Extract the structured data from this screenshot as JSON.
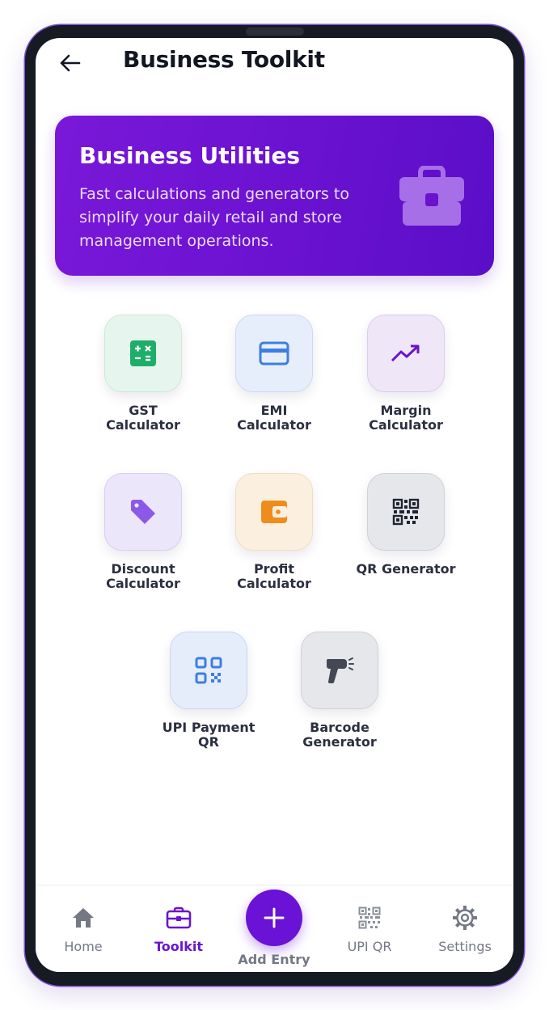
{
  "header": {
    "title": "Business Toolkit"
  },
  "hero": {
    "title": "Business Utilities",
    "description": "Fast calculations and generators to simplify your daily retail and store management operations."
  },
  "tools": [
    {
      "line1": "GST",
      "line2": "Calculator",
      "icon": "calculator-icon"
    },
    {
      "line1": "EMI",
      "line2": "Calculator",
      "icon": "credit-card-icon"
    },
    {
      "line1": "Margin",
      "line2": "Calculator",
      "icon": "trending-up-icon"
    },
    {
      "line1": "Discount",
      "line2": "Calculator",
      "icon": "tag-icon"
    },
    {
      "line1": "Profit",
      "line2": "Calculator",
      "icon": "wallet-icon"
    },
    {
      "line1": "QR Generator",
      "line2": "",
      "icon": "qr-code-icon"
    },
    {
      "line1": "UPI Payment",
      "line2": "QR",
      "icon": "qr-scan-icon"
    },
    {
      "line1": "Barcode",
      "line2": "Generator",
      "icon": "barcode-scanner-icon"
    }
  ],
  "nav": {
    "home": "Home",
    "toolkit": "Toolkit",
    "add_entry": "Add Entry",
    "upi_qr": "UPI QR",
    "settings": "Settings",
    "active": "toolkit"
  },
  "colors": {
    "accent": "#6a12d6",
    "hero_gradient_start": "#7a18d8",
    "hero_gradient_end": "#5a0ec8"
  }
}
